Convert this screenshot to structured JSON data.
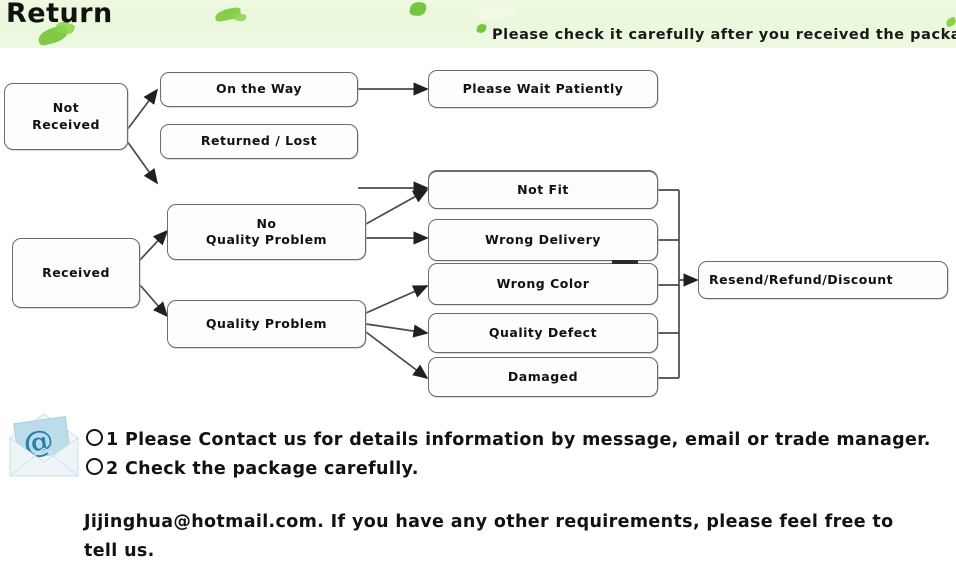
{
  "banner": {
    "title": "Return",
    "subtitle": "Please check it carefully after you received the package",
    "background_color": "#eaf8dc",
    "leaf_color": "#7ec832"
  },
  "flowchart": {
    "nodes": [
      {
        "id": "not-received",
        "label": "Not\nReceived"
      },
      {
        "id": "on-the-way",
        "label": "On the Way"
      },
      {
        "id": "returned-lost",
        "label": "Returned / Lost"
      },
      {
        "id": "please-wait",
        "label": "Please Wait Patiently"
      },
      {
        "id": "resend-refund",
        "label": "Resend / Refund"
      },
      {
        "id": "received",
        "label": "Received"
      },
      {
        "id": "no-quality",
        "label": "No\nQuality Problem"
      },
      {
        "id": "quality-problem",
        "label": "Quality Problem"
      },
      {
        "id": "not-fit",
        "label": "Not Fit"
      },
      {
        "id": "wrong-delivery",
        "label": "Wrong Delivery"
      },
      {
        "id": "wrong-color",
        "label": "Wrong Color"
      },
      {
        "id": "quality-defect",
        "label": "Quality Defect"
      },
      {
        "id": "damaged",
        "label": "Damaged"
      },
      {
        "id": "final-outcome",
        "label": "Resend/Refund/Discount"
      }
    ],
    "edges": [
      {
        "from": "not-received",
        "to": "on-the-way"
      },
      {
        "from": "not-received",
        "to": "returned-lost"
      },
      {
        "from": "on-the-way",
        "to": "please-wait"
      },
      {
        "from": "returned-lost",
        "to": "resend-refund"
      },
      {
        "from": "received",
        "to": "no-quality"
      },
      {
        "from": "received",
        "to": "quality-problem"
      },
      {
        "from": "no-quality",
        "to": "not-fit"
      },
      {
        "from": "no-quality",
        "to": "wrong-delivery"
      },
      {
        "from": "quality-problem",
        "to": "wrong-color"
      },
      {
        "from": "quality-problem",
        "to": "quality-defect"
      },
      {
        "from": "quality-problem",
        "to": "damaged"
      },
      {
        "from": "not-fit",
        "to": "final-outcome"
      },
      {
        "from": "wrong-delivery",
        "to": "final-outcome"
      },
      {
        "from": "wrong-color",
        "to": "final-outcome"
      },
      {
        "from": "quality-defect",
        "to": "final-outcome"
      },
      {
        "from": "damaged",
        "to": "final-outcome"
      }
    ],
    "border_color": "#6b6b6b"
  },
  "notes": {
    "icon": "envelope-at-icon",
    "items": [
      {
        "number": "1",
        "text": "Please Contact us for details information by message, email or trade manager."
      },
      {
        "number": "2",
        "text": "Check the package carefully."
      }
    ],
    "paragraph_line1": "Jijinghua@hotmail.com. If you have any other requirements, please feel free to",
    "paragraph_line2": "tell us.",
    "email": "Jijinghua@hotmail.com"
  }
}
